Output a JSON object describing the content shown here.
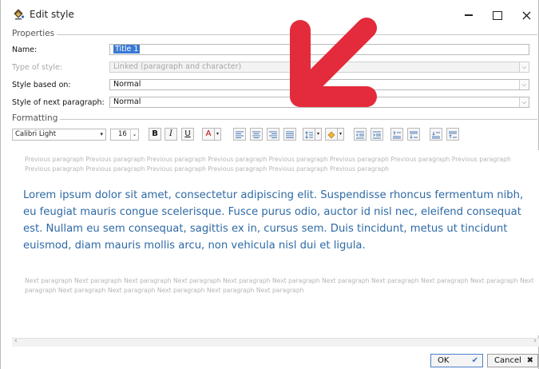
{
  "window": {
    "title": "Edit style",
    "icon": "paint-bucket-icon"
  },
  "properties": {
    "group_label": "Properties",
    "name_label": "Name:",
    "name_value": "Title 1",
    "type_label": "Type of style:",
    "type_value": "Linked (paragraph and character)",
    "based_on_label": "Style based on:",
    "based_on_value": "Normal",
    "next_label": "Style of next paragraph:",
    "next_value": "Normal"
  },
  "formatting": {
    "group_label": "Formatting",
    "font": "Calibri Light",
    "size": "16",
    "bold": "B",
    "italic": "I",
    "underline": "U",
    "font_color_glyph": "A"
  },
  "preview": {
    "previous_text": "Previous paragraph Previous paragraph Previous paragraph Previous paragraph Previous paragraph Previous paragraph Previous paragraph Previous paragraph Previous paragraph Previous paragraph Previous paragraph Previous paragraph Previous paragraph Previous paragraph",
    "main_text": "Lorem ipsum dolor sit amet, consectetur adipiscing elit. Suspendisse rhoncus fermentum nibh, eu feugiat mauris congue scelerisque. Fusce purus odio, auctor id nisl nec, eleifend consequat est. Nullam eu sem consequat, sagittis ex in, cursus sem. Duis tincidunt, metus ut tincidunt euismod, diam mauris mollis arcu, non vehicula nisl dui et ligula.",
    "next_text": "Next paragraph Next paragraph Next paragraph Next paragraph Next paragraph Next paragraph Next paragraph Next paragraph Next paragraph Next paragraph Next paragraph Next paragraph Next paragraph Next paragraph Next paragraph Next paragraph",
    "main_color": "#2e6aa6"
  },
  "buttons": {
    "ok": "OK",
    "cancel": "Cancel"
  },
  "overlay": {
    "arrow_color": "#e32b3c"
  }
}
